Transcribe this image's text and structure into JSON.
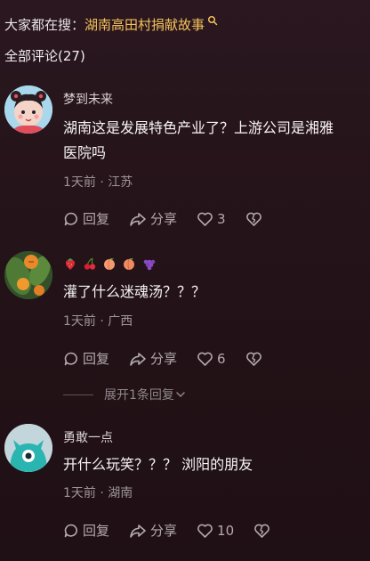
{
  "search": {
    "prefix": "大家都在搜：",
    "query": "湖南高田村捐献故事"
  },
  "comments_header": "全部评论(27)",
  "comments": [
    {
      "username": "梦到未来",
      "text_line1": "湖南这是发展特色产业了？上游公司是湘雅",
      "text_line2": "医院吗",
      "meta": "1天前 · 江苏",
      "reply": "回复",
      "share": "分享",
      "likes": "3"
    },
    {
      "username_emojis": [
        "strawberry",
        "cherries",
        "peach",
        "peach",
        "grapes"
      ],
      "text_line1": "灌了什么迷魂汤？？？",
      "meta": "1天前 · 广西",
      "reply": "回复",
      "share": "分享",
      "likes": "6"
    },
    {
      "username": "勇敢一点",
      "text_line1": "开什么玩笑？？？ 浏阳的朋友",
      "meta": "1天前 · 湖南",
      "reply": "回复",
      "share": "分享",
      "likes": "10"
    }
  ],
  "expand_replies": "展开1条回复",
  "colors": {
    "background": "#24131a",
    "search_highlight": "#f3c15a",
    "muted_text": "#9e9599"
  }
}
